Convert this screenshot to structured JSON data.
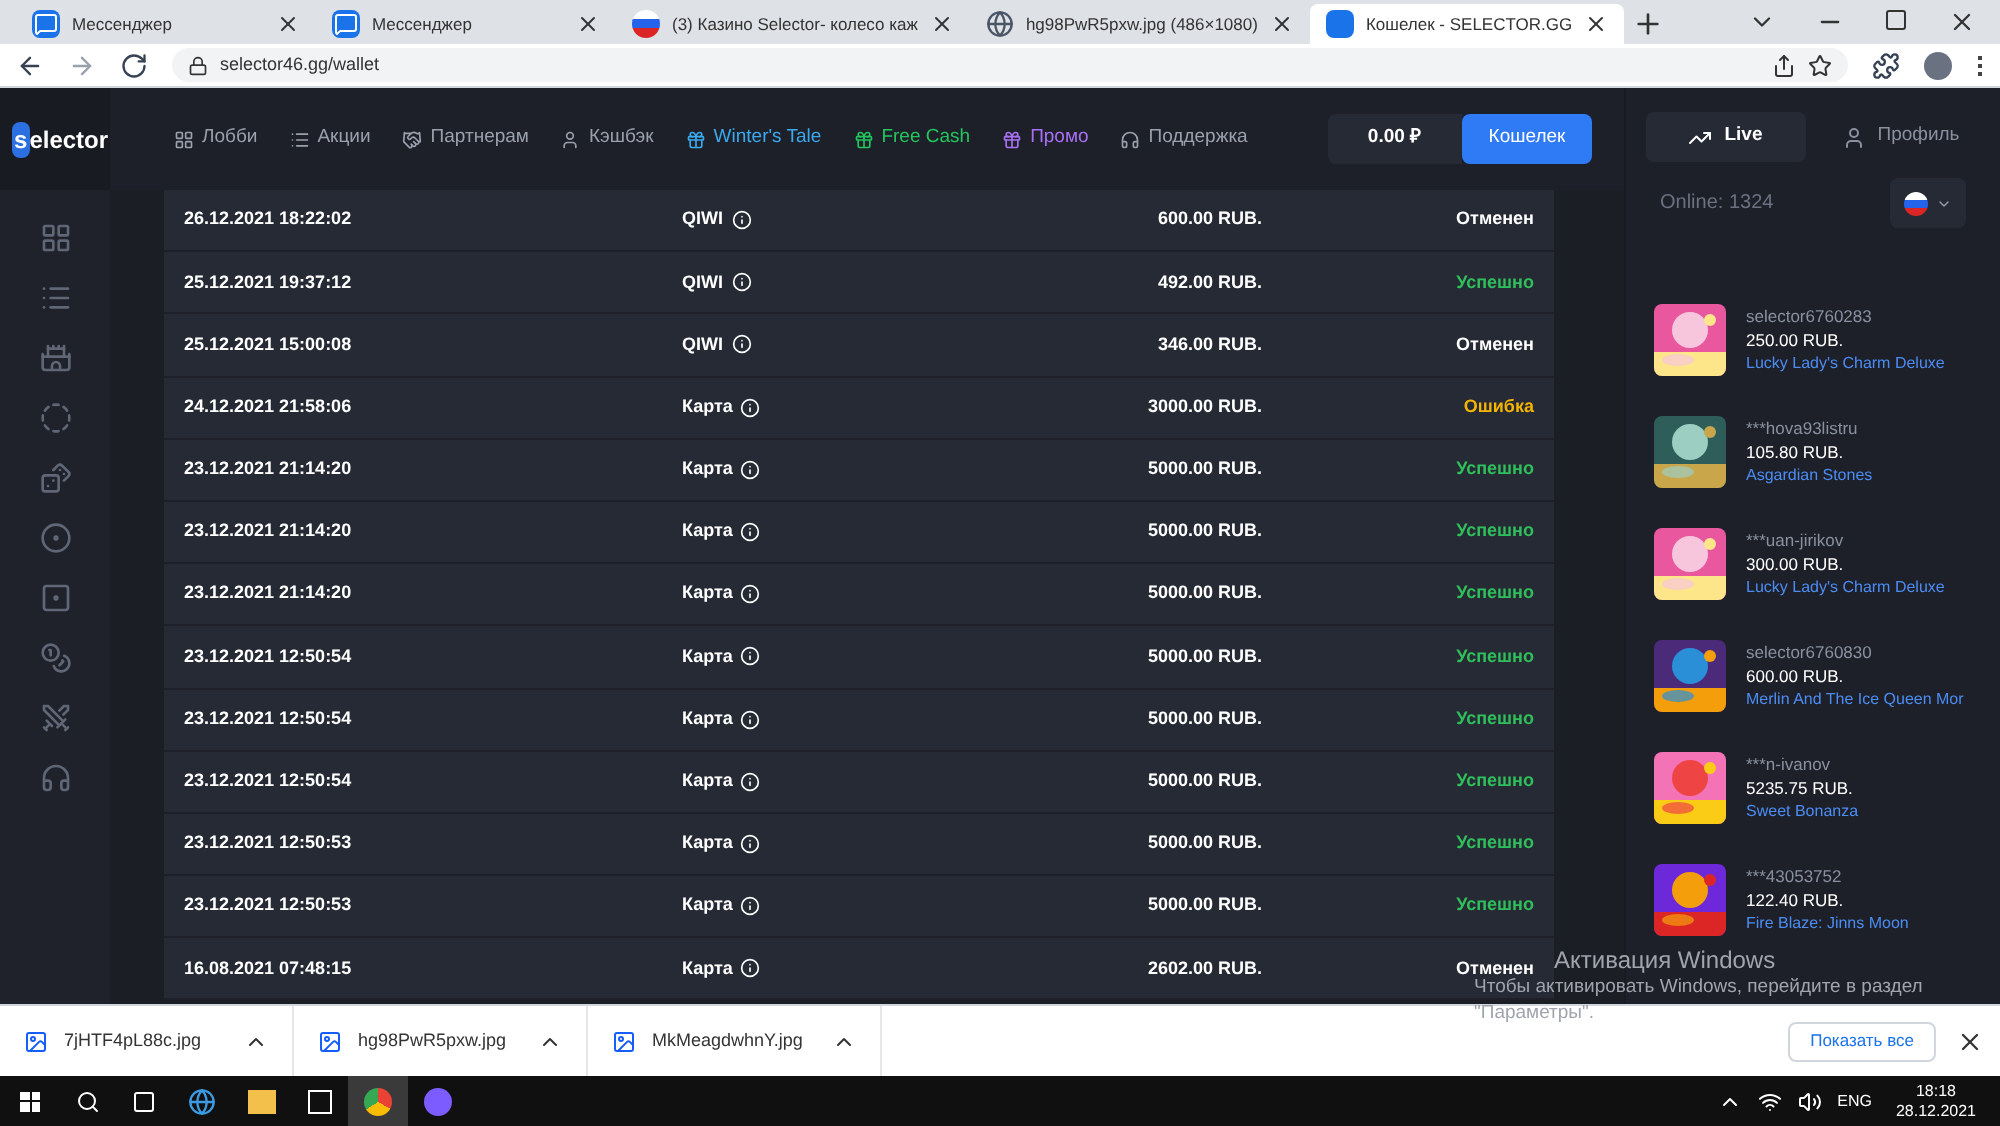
{
  "browser": {
    "tabs": [
      {
        "title": "Мессенджер",
        "selected": false
      },
      {
        "title": "Мессенджер",
        "selected": false
      },
      {
        "title": "(3) Казино Selector- колесо каж",
        "selected": false
      },
      {
        "title": "hg98PwR5pxw.jpg (486×1080)",
        "selected": false
      },
      {
        "title": "Кошелек - SELECTOR.GG",
        "selected": true
      }
    ],
    "address": "selector46.gg/wallet"
  },
  "site": {
    "logo": {
      "letter": "s",
      "rest": "elector"
    },
    "nav": [
      {
        "label": "Лобби",
        "color": "#9aa0ad"
      },
      {
        "label": "Акции",
        "color": "#9aa0ad"
      },
      {
        "label": "Партнерам",
        "color": "#9aa0ad"
      },
      {
        "label": "Кэшбэк",
        "color": "#9aa0ad"
      },
      {
        "label": "Winter's Tale",
        "color": "#3ba9ee"
      },
      {
        "label": "Free Cash",
        "color": "#22c55e"
      },
      {
        "label": "Промо",
        "color": "#a970f5"
      },
      {
        "label": "Поддержка",
        "color": "#9aa0ad"
      }
    ],
    "balance": "0.00 ₽",
    "wallet_button": "Кошелек",
    "table": {
      "rows": [
        {
          "date": "26.12.2021 18:22:02",
          "method": "QIWI",
          "amount": "600.00 RUB.",
          "status": "Отменен",
          "color": "#ffffff"
        },
        {
          "date": "25.12.2021 19:37:12",
          "method": "QIWI",
          "amount": "492.00 RUB.",
          "status": "Успешно",
          "color": "#2fbf5b"
        },
        {
          "date": "25.12.2021 15:00:08",
          "method": "QIWI",
          "amount": "346.00 RUB.",
          "status": "Отменен",
          "color": "#ffffff"
        },
        {
          "date": "24.12.2021 21:58:06",
          "method": "Карта",
          "amount": "3000.00 RUB.",
          "status": "Ошибка",
          "color": "#f5b400"
        },
        {
          "date": "23.12.2021 21:14:20",
          "method": "Карта",
          "amount": "5000.00 RUB.",
          "status": "Успешно",
          "color": "#2fbf5b"
        },
        {
          "date": "23.12.2021 21:14:20",
          "method": "Карта",
          "amount": "5000.00 RUB.",
          "status": "Успешно",
          "color": "#2fbf5b"
        },
        {
          "date": "23.12.2021 21:14:20",
          "method": "Карта",
          "amount": "5000.00 RUB.",
          "status": "Успешно",
          "color": "#2fbf5b"
        },
        {
          "date": "23.12.2021 12:50:54",
          "method": "Карта",
          "amount": "5000.00 RUB.",
          "status": "Успешно",
          "color": "#2fbf5b"
        },
        {
          "date": "23.12.2021 12:50:54",
          "method": "Карта",
          "amount": "5000.00 RUB.",
          "status": "Успешно",
          "color": "#2fbf5b"
        },
        {
          "date": "23.12.2021 12:50:54",
          "method": "Карта",
          "amount": "5000.00 RUB.",
          "status": "Успешно",
          "color": "#2fbf5b"
        },
        {
          "date": "23.12.2021 12:50:53",
          "method": "Карта",
          "amount": "5000.00 RUB.",
          "status": "Успешно",
          "color": "#2fbf5b"
        },
        {
          "date": "23.12.2021 12:50:53",
          "method": "Карта",
          "amount": "5000.00 RUB.",
          "status": "Успешно",
          "color": "#2fbf5b"
        },
        {
          "date": "16.08.2021 07:48:15",
          "method": "Карта",
          "amount": "2602.00 RUB.",
          "status": "Отменен",
          "color": "#ffffff"
        }
      ]
    },
    "right_panel": {
      "tabs": [
        {
          "label": "Live",
          "selected": true
        },
        {
          "label": "Профиль",
          "selected": false
        }
      ],
      "online": "Online: 1324",
      "feed": [
        {
          "user": "selector6760283",
          "amount": "250.00 RUB.",
          "game": "Lucky Lady's Charm Deluxe"
        },
        {
          "user": "***hova93listru",
          "amount": "105.80 RUB.",
          "game": "Asgardian Stones"
        },
        {
          "user": "***uan-jirikov",
          "amount": "300.00 RUB.",
          "game": "Lucky Lady's Charm Deluxe"
        },
        {
          "user": "selector6760830",
          "amount": "600.00 RUB.",
          "game": "Merlin And The Ice Queen Mor"
        },
        {
          "user": "***n-ivanov",
          "amount": "5235.75 RUB.",
          "game": "Sweet Bonanza"
        },
        {
          "user": "***43053752",
          "amount": "122.40 RUB.",
          "game": "Fire Blaze: Jinns Moon"
        }
      ]
    }
  },
  "activation": {
    "title": "Активация Windows",
    "line1": "Чтобы активировать Windows, перейдите в раздел",
    "line2": "\"Параметры\"."
  },
  "downloads": {
    "items": [
      "7jHTF4pL88c.jpg",
      "hg98PwR5pxw.jpg",
      "MkMeagdwhnY.jpg"
    ],
    "show_all": "Показать все"
  },
  "taskbar": {
    "lang": "ENG",
    "time": "18:18",
    "date": "28.12.2021"
  }
}
